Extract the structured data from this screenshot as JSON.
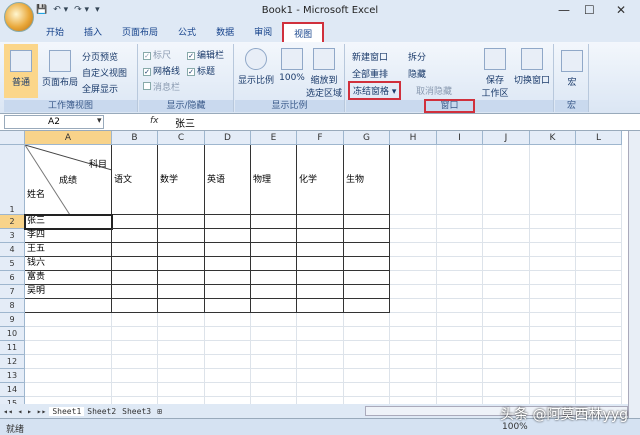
{
  "title": "Book1 - Microsoft Excel",
  "window_buttons": [
    "—",
    "☐",
    "✕"
  ],
  "qat": [
    "💾",
    "↶ ▾",
    "↷ ▾",
    "▾"
  ],
  "tabs": [
    "开始",
    "插入",
    "页面布局",
    "公式",
    "数据",
    "审阅",
    "视图"
  ],
  "active_tab": "视图",
  "ribbon": {
    "workbook_views": {
      "label": "工作簿视图",
      "normal": "普通",
      "page_layout": "页面布局",
      "page_break": "分页预览",
      "custom": "自定义视图",
      "fullscreen": "全屏显示"
    },
    "show_hide": {
      "label": "显示/隐藏",
      "ruler": "标尺",
      "formula_bar": "编辑栏",
      "gridlines": "网格线",
      "headings": "标题",
      "message_bar": "消息栏"
    },
    "zoom": {
      "label": "显示比例",
      "zoom": "显示比例",
      "hundred": "100%",
      "zoom_sel_1": "缩放到",
      "zoom_sel_2": "选定区域"
    },
    "window": {
      "label": "窗口",
      "new_window": "新建窗口",
      "arrange_all": "全部重排",
      "freeze": "冻结窗格",
      "split": "拆分",
      "hide": "隐藏",
      "unhide": "取消隐藏",
      "save_ws_1": "保存",
      "save_ws_2": "工作区",
      "switch": "切换窗口"
    },
    "macros": {
      "label": "宏",
      "macros": "宏"
    }
  },
  "formula_bar": {
    "name_box": "A2",
    "fx": "fx",
    "value": "张三"
  },
  "columns": [
    "A",
    "B",
    "C",
    "D",
    "E",
    "F",
    "G",
    "H",
    "I",
    "J",
    "K",
    "L"
  ],
  "rows": [
    "1",
    "2",
    "3",
    "4",
    "5",
    "6",
    "7",
    "8",
    "9",
    "10",
    "11",
    "12",
    "13",
    "14",
    "15"
  ],
  "header_cell": {
    "subject": "科目",
    "score": "成绩",
    "name": "姓名"
  },
  "subjects": [
    "语文",
    "数学",
    "英语",
    "物理",
    "化学",
    "生物"
  ],
  "names": [
    "张三",
    "李四",
    "王五",
    "钱六",
    "富贵",
    "吴明"
  ],
  "sheets": [
    "Sheet1",
    "Sheet2",
    "Sheet3"
  ],
  "status": {
    "ready": "就绪",
    "zoom": "100%"
  },
  "watermark": "头条 @阿莫西林yyg"
}
